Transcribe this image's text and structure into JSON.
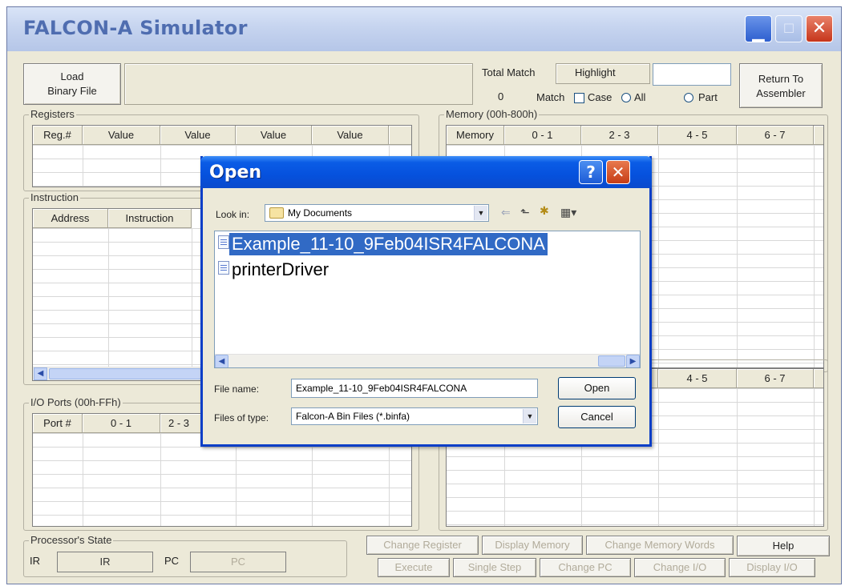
{
  "window": {
    "title": "FALCON-A Simulator"
  },
  "toolbar": {
    "load_label": "Load\nBinary File",
    "total_match_label": "Total Match",
    "total_match_value": "0",
    "highlight_label": "Highlight",
    "match_label": "Match",
    "case_label": "Case",
    "all_label": "All",
    "part_label": "Part",
    "return_label": "Return To\nAssembler"
  },
  "registers": {
    "legend": "Registers",
    "columns": [
      "Reg.#",
      "Value",
      "Value",
      "Value",
      "Value"
    ]
  },
  "instruction": {
    "legend": "Instruction",
    "columns": [
      "Address",
      "Instruction"
    ]
  },
  "memory": {
    "legend": "Memory (00h-800h)",
    "columns": [
      "Memory",
      "0 - 1",
      "2 - 3",
      "4 - 5",
      "6 - 7"
    ],
    "lower_columns": [
      "4 - 5",
      "6 - 7"
    ]
  },
  "io_ports": {
    "legend": "I/O Ports (00h-FFh)",
    "columns": [
      "Port #",
      "0 - 1",
      "2 - 3"
    ]
  },
  "processor_state": {
    "legend": "Processor's State",
    "ir_label": "IR",
    "ir_value": "IR",
    "pc_label": "PC",
    "pc_value": "PC"
  },
  "bottom_buttons": {
    "change_register": "Change Register",
    "display_memory": "Display Memory",
    "change_memory_words": "Change Memory Words",
    "help": "Help",
    "execute": "Execute",
    "single_step": "Single Step",
    "change_pc": "Change PC",
    "change_io": "Change I/O",
    "display_io": "Display I/O"
  },
  "dialog": {
    "title": "Open",
    "look_in_label": "Look in:",
    "look_in_value": "My Documents",
    "files": [
      {
        "name": "Example_11-10_9Feb04ISR4FALCONA",
        "selected": true
      },
      {
        "name": "printerDriver",
        "selected": false
      }
    ],
    "file_name_label": "File name:",
    "file_name_value": "Example_11-10_9Feb04ISR4FALCONA",
    "files_of_type_label": "Files of type:",
    "files_of_type_value": "Falcon-A Bin Files (*.binfa)",
    "open_button": "Open",
    "cancel_button": "Cancel"
  }
}
